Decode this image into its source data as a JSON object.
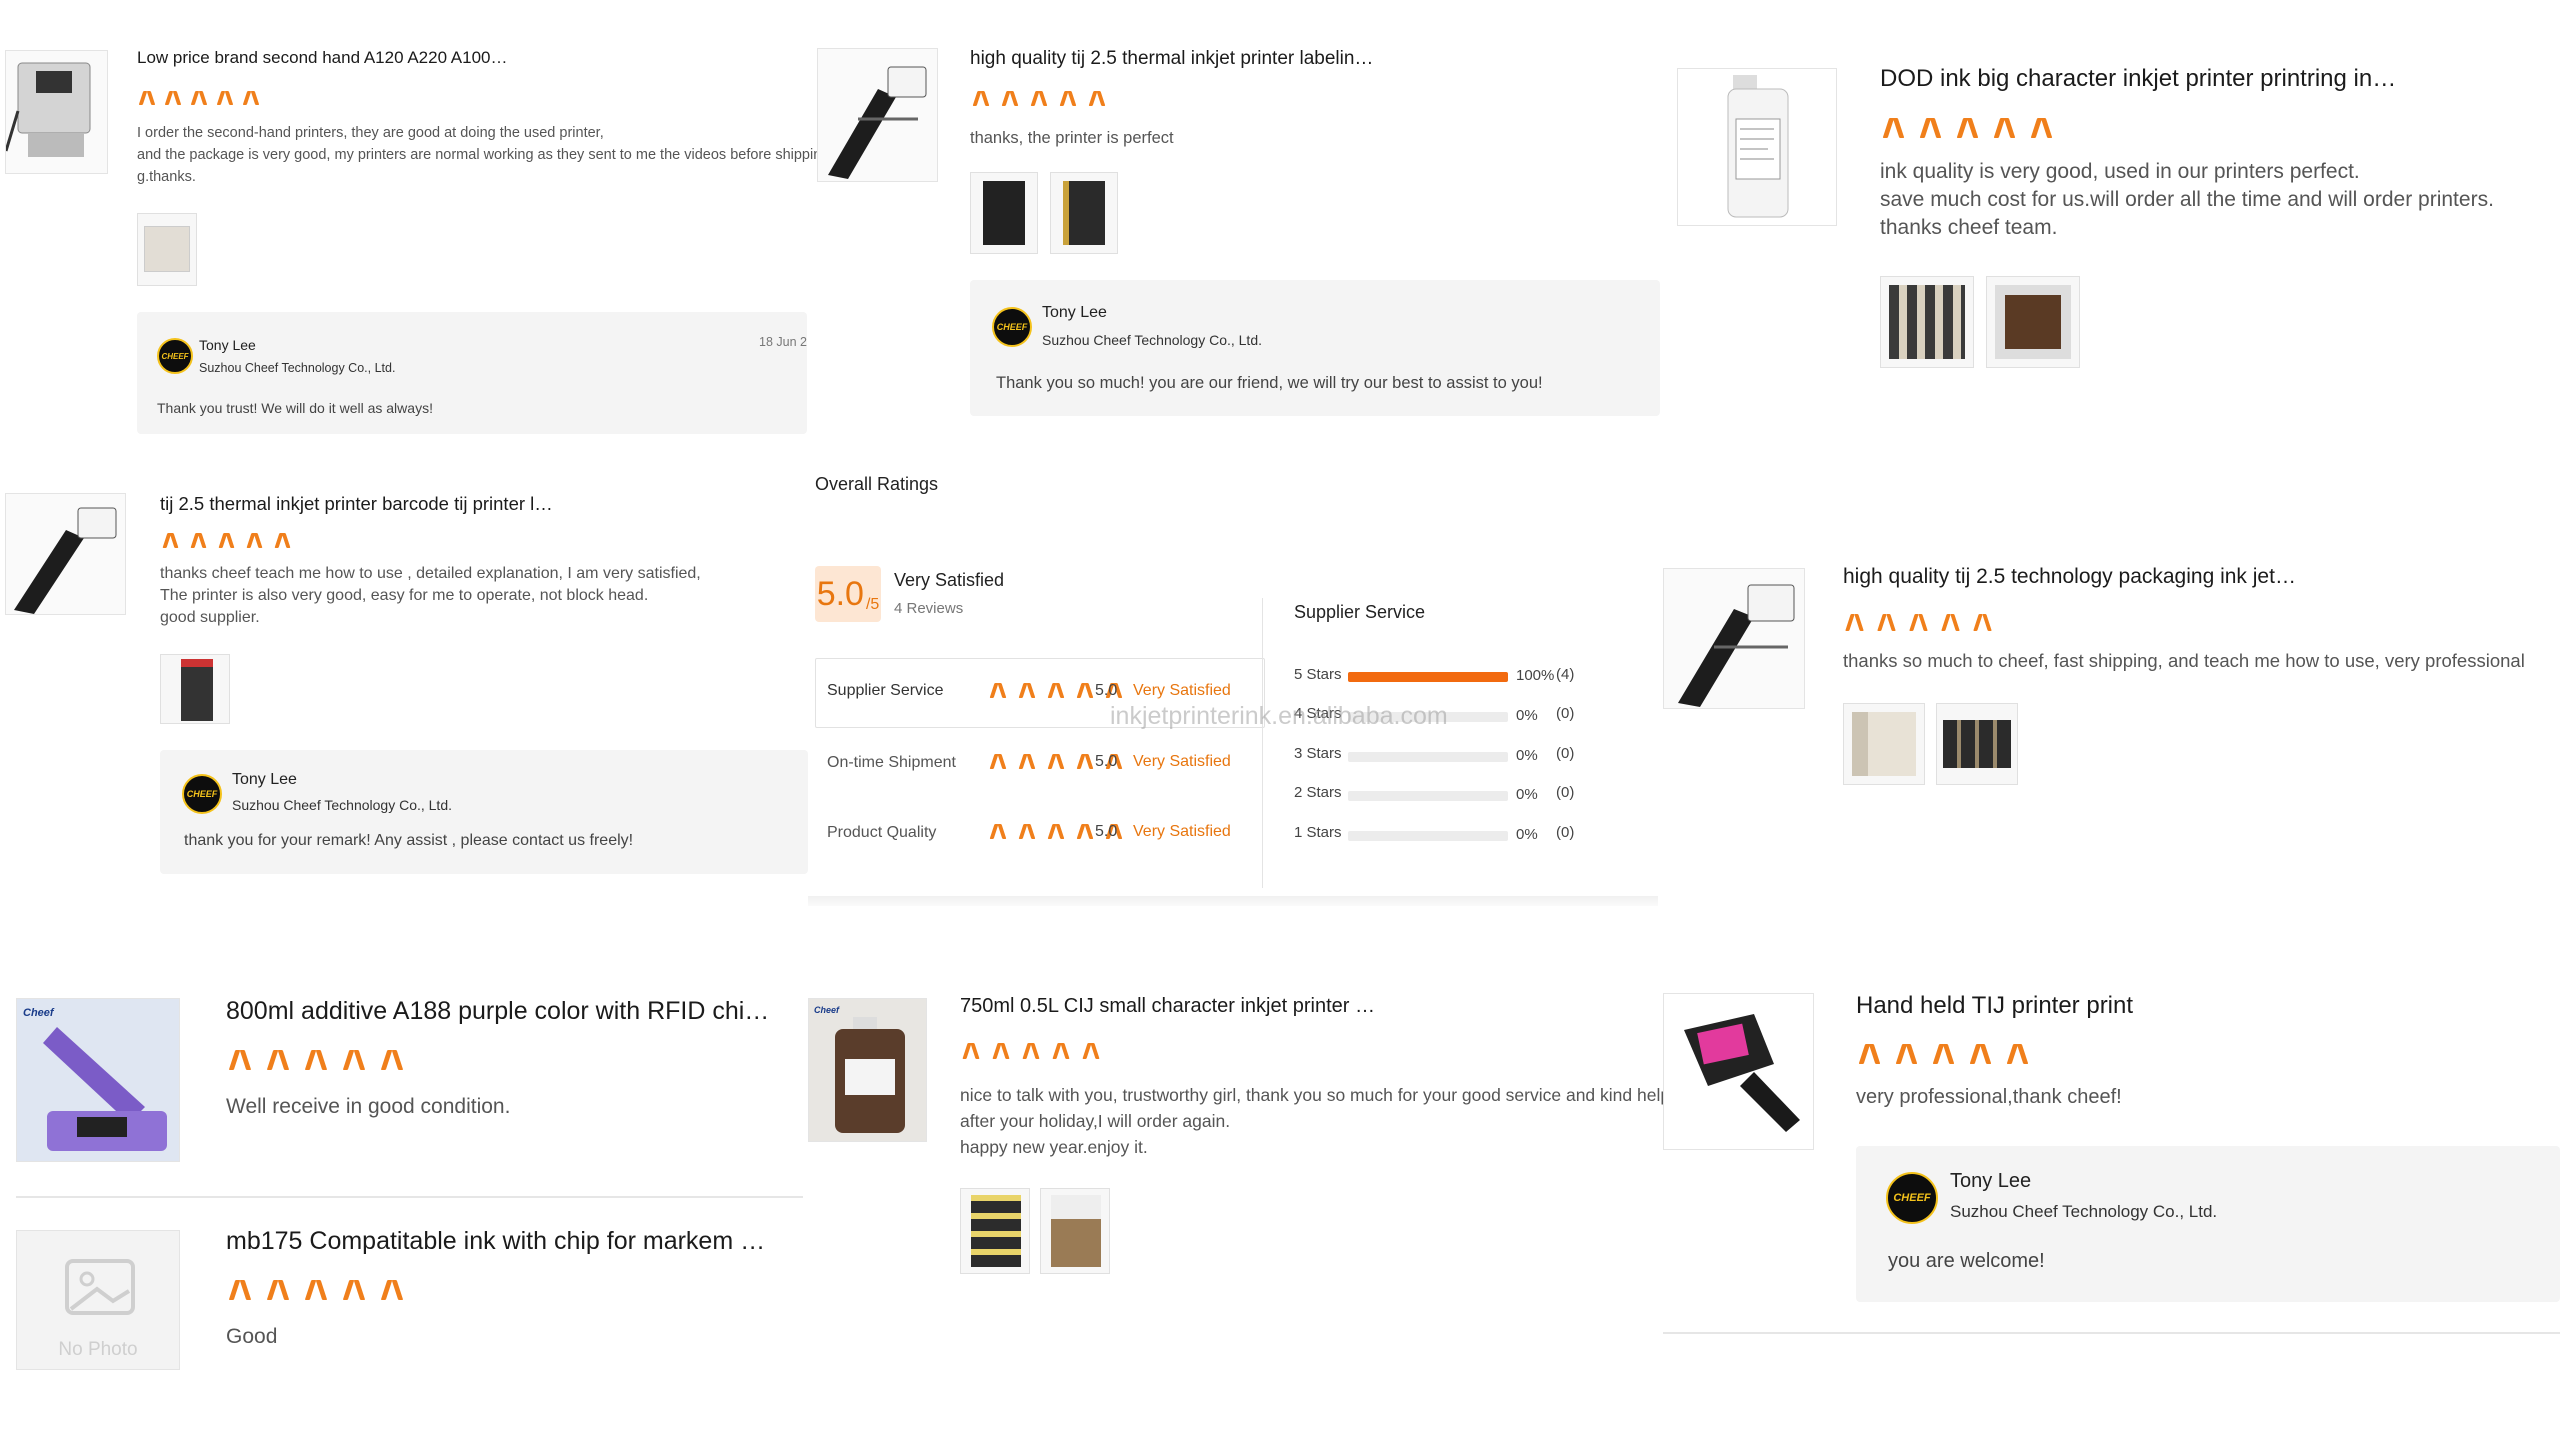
{
  "reviews": [
    {
      "title": "Low price brand second hand A120 A220 A100…",
      "lines": [
        "I order the second-hand printers, they are good at doing the used printer,",
        "and the package is very good, my printers are normal working as they sent to me the videos before shippin",
        "g.thanks."
      ],
      "reply": {
        "name": "Tony Lee",
        "company": "Suzhou Cheef Technology Co., Ltd.",
        "message": "Thank you trust! We will do it well as always!",
        "date": "18 Jun 2"
      }
    },
    {
      "title": "high quality tij 2.5 thermal inkjet printer labelin…",
      "lines": [
        "thanks, the printer is perfect"
      ],
      "reply": {
        "name": "Tony Lee",
        "company": "Suzhou Cheef Technology Co., Ltd.",
        "message": "Thank you so much! you are our friend, we will try our best to assist to you!"
      }
    },
    {
      "title": "DOD ink big character inkjet printer printring in…",
      "lines": [
        "ink quality is very good, used in our printers perfect.",
        "save much cost for us.will order all the time and will order printers.",
        "thanks cheef team."
      ]
    },
    {
      "title": "tij 2.5 thermal inkjet printer barcode tij printer l…",
      "lines": [
        "thanks cheef teach me how to use , detailed explanation, I am very satisfied,",
        "The printer is also very good, easy for me to operate, not block head.",
        "good supplier."
      ],
      "reply": {
        "name": "Tony Lee",
        "company": "Suzhou Cheef Technology Co., Ltd.",
        "message": "thank you for your remark! Any assist , please contact us freely!"
      }
    },
    {
      "title": "high quality tij 2.5 technology packaging ink jet…",
      "lines": [
        "thanks so much to cheef,  fast shipping, and teach me how to use, very professional"
      ]
    },
    {
      "title": "800ml additive A188 purple color with RFID chi…",
      "lines": [
        "Well receive in good condition."
      ],
      "brand": "Cheef"
    },
    {
      "title": "mb175 Compatitable ink with chip for markem …",
      "lines": [
        "Good"
      ],
      "no_photo": "No Photo"
    },
    {
      "title": "750ml 0.5L CIJ small character inkjet printer s…",
      "lines": [
        "nice to talk with you, trustworthy girl, thank you so much for your good service and kind help.",
        "after your holiday,I will order again.",
        "happy new year.enjoy it."
      ],
      "brand": "Cheef"
    },
    {
      "title": "Hand held TIJ printer print",
      "lines": [
        "very professional,thank cheef!"
      ],
      "reply": {
        "name": "Tony Lee",
        "company": "Suzhou Cheef Technology Co., Ltd.",
        "message": "you are welcome!"
      }
    }
  ],
  "overall": {
    "heading": "Overall Ratings",
    "score": "5.0",
    "score_max": "/5",
    "label": "Very Satisfied",
    "reviews_count": "4 Reviews",
    "categories": [
      {
        "name": "Supplier Service",
        "score": "5.0",
        "label": "Very Satisfied",
        "stars": 5
      },
      {
        "name": "On-time Shipment",
        "score": "5.0",
        "label": "Very Satisfied",
        "stars": 5
      },
      {
        "name": "Product Quality",
        "score": "5.0",
        "label": "Very Satisfied",
        "stars": 5
      }
    ],
    "breakdown_title": "Supplier Service",
    "breakdown": [
      {
        "label": "5 Stars",
        "fraction": 1.0,
        "percent": "100%",
        "count": "(4)"
      },
      {
        "label": "4 Stars",
        "fraction": 0,
        "percent": "0%",
        "count": "(0)"
      },
      {
        "label": "3 Stars",
        "fraction": 0,
        "percent": "0%",
        "count": "(0)"
      },
      {
        "label": "2 Stars",
        "fraction": 0,
        "percent": "0%",
        "count": "(0)"
      },
      {
        "label": "1 Stars",
        "fraction": 0,
        "percent": "0%",
        "count": "(0)"
      }
    ],
    "watermark": "inkjetprinterink.en.alibaba.com"
  },
  "logo_text": "CHEEF",
  "colors": {
    "star": "#f07f1b",
    "bar": "#f26a0f",
    "reply_bg": "#f4f4f4",
    "score_bg": "#fde6d3",
    "satisfied": "#e8760f"
  },
  "rating_stars": 5
}
